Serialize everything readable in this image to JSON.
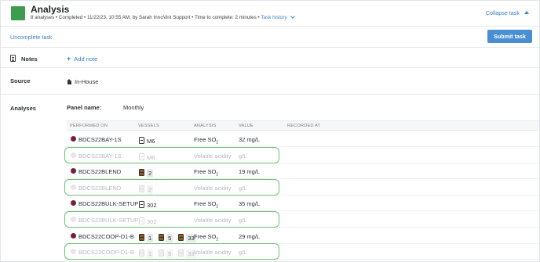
{
  "header": {
    "title": "Analysis",
    "meta_summary": "8 analyses • Completed • 11/22/23, 10:55 AM, by Sarah InnoVint Support • Time to complete: 2 minutes •",
    "task_history_label": "Task history",
    "collapse_label": "Collapse task",
    "status_color": "#3c9d4e"
  },
  "actions": {
    "uncomplete_label": "Uncomplete task",
    "submit_label": "Submit task"
  },
  "notes": {
    "label": "Notes",
    "add_label": "Add note"
  },
  "source": {
    "label": "Source",
    "value": "In-House"
  },
  "analyses": {
    "label": "Analyses",
    "panel_label": "Panel name:",
    "panel_value": "Monthly",
    "columns": [
      "PERFORMED ON",
      "VESSELS",
      "ANALYSIS",
      "VALUE",
      "RECORDED AT"
    ],
    "rows": [
      {
        "lot": "BDCS22BAY-1S",
        "vessel_type": "tank",
        "vessels": [
          "M6"
        ],
        "analysis_main": "Free SO",
        "analysis_sub": "2",
        "value": "32 mg/L",
        "muted": false
      },
      {
        "lot": "BDCS22BAY-1S",
        "vessel_type": "tank",
        "vessels": [
          "M6"
        ],
        "analysis_main": "Volatile acidity",
        "analysis_sub": "",
        "value": "g/L",
        "muted": true
      },
      {
        "lot": "BDCS22BLEND",
        "vessel_type": "barrel",
        "vessels": [
          "2"
        ],
        "analysis_main": "Free SO",
        "analysis_sub": "2",
        "value": "19 mg/L",
        "muted": false
      },
      {
        "lot": "BDCS22BLEND",
        "vessel_type": "barrel",
        "vessels": [
          "2"
        ],
        "analysis_main": "Volatile acidity",
        "analysis_sub": "",
        "value": "g/L",
        "muted": true
      },
      {
        "lot": "BDCS22BULK-SETUP",
        "vessel_type": "tank",
        "vessels": [
          "302"
        ],
        "analysis_main": "Free SO",
        "analysis_sub": "2",
        "value": "35 mg/L",
        "muted": false
      },
      {
        "lot": "BDCS22BULK-SETUP",
        "vessel_type": "tank",
        "vessels": [
          "302"
        ],
        "analysis_main": "Volatile acidity",
        "analysis_sub": "",
        "value": "g/L",
        "muted": true
      },
      {
        "lot": "BDCS22COOP-D1-B",
        "vessel_type": "barrel",
        "vessels": [
          "1",
          "5",
          "33"
        ],
        "analysis_main": "Free SO",
        "analysis_sub": "2",
        "value": "29 mg/L",
        "muted": false
      },
      {
        "lot": "BDCS22COOP-D1-B",
        "vessel_type": "barrel",
        "vessels": [
          "1",
          "5",
          "33"
        ],
        "analysis_main": "Volatile acidity",
        "analysis_sub": "",
        "value": "g/L",
        "muted": true
      }
    ]
  }
}
